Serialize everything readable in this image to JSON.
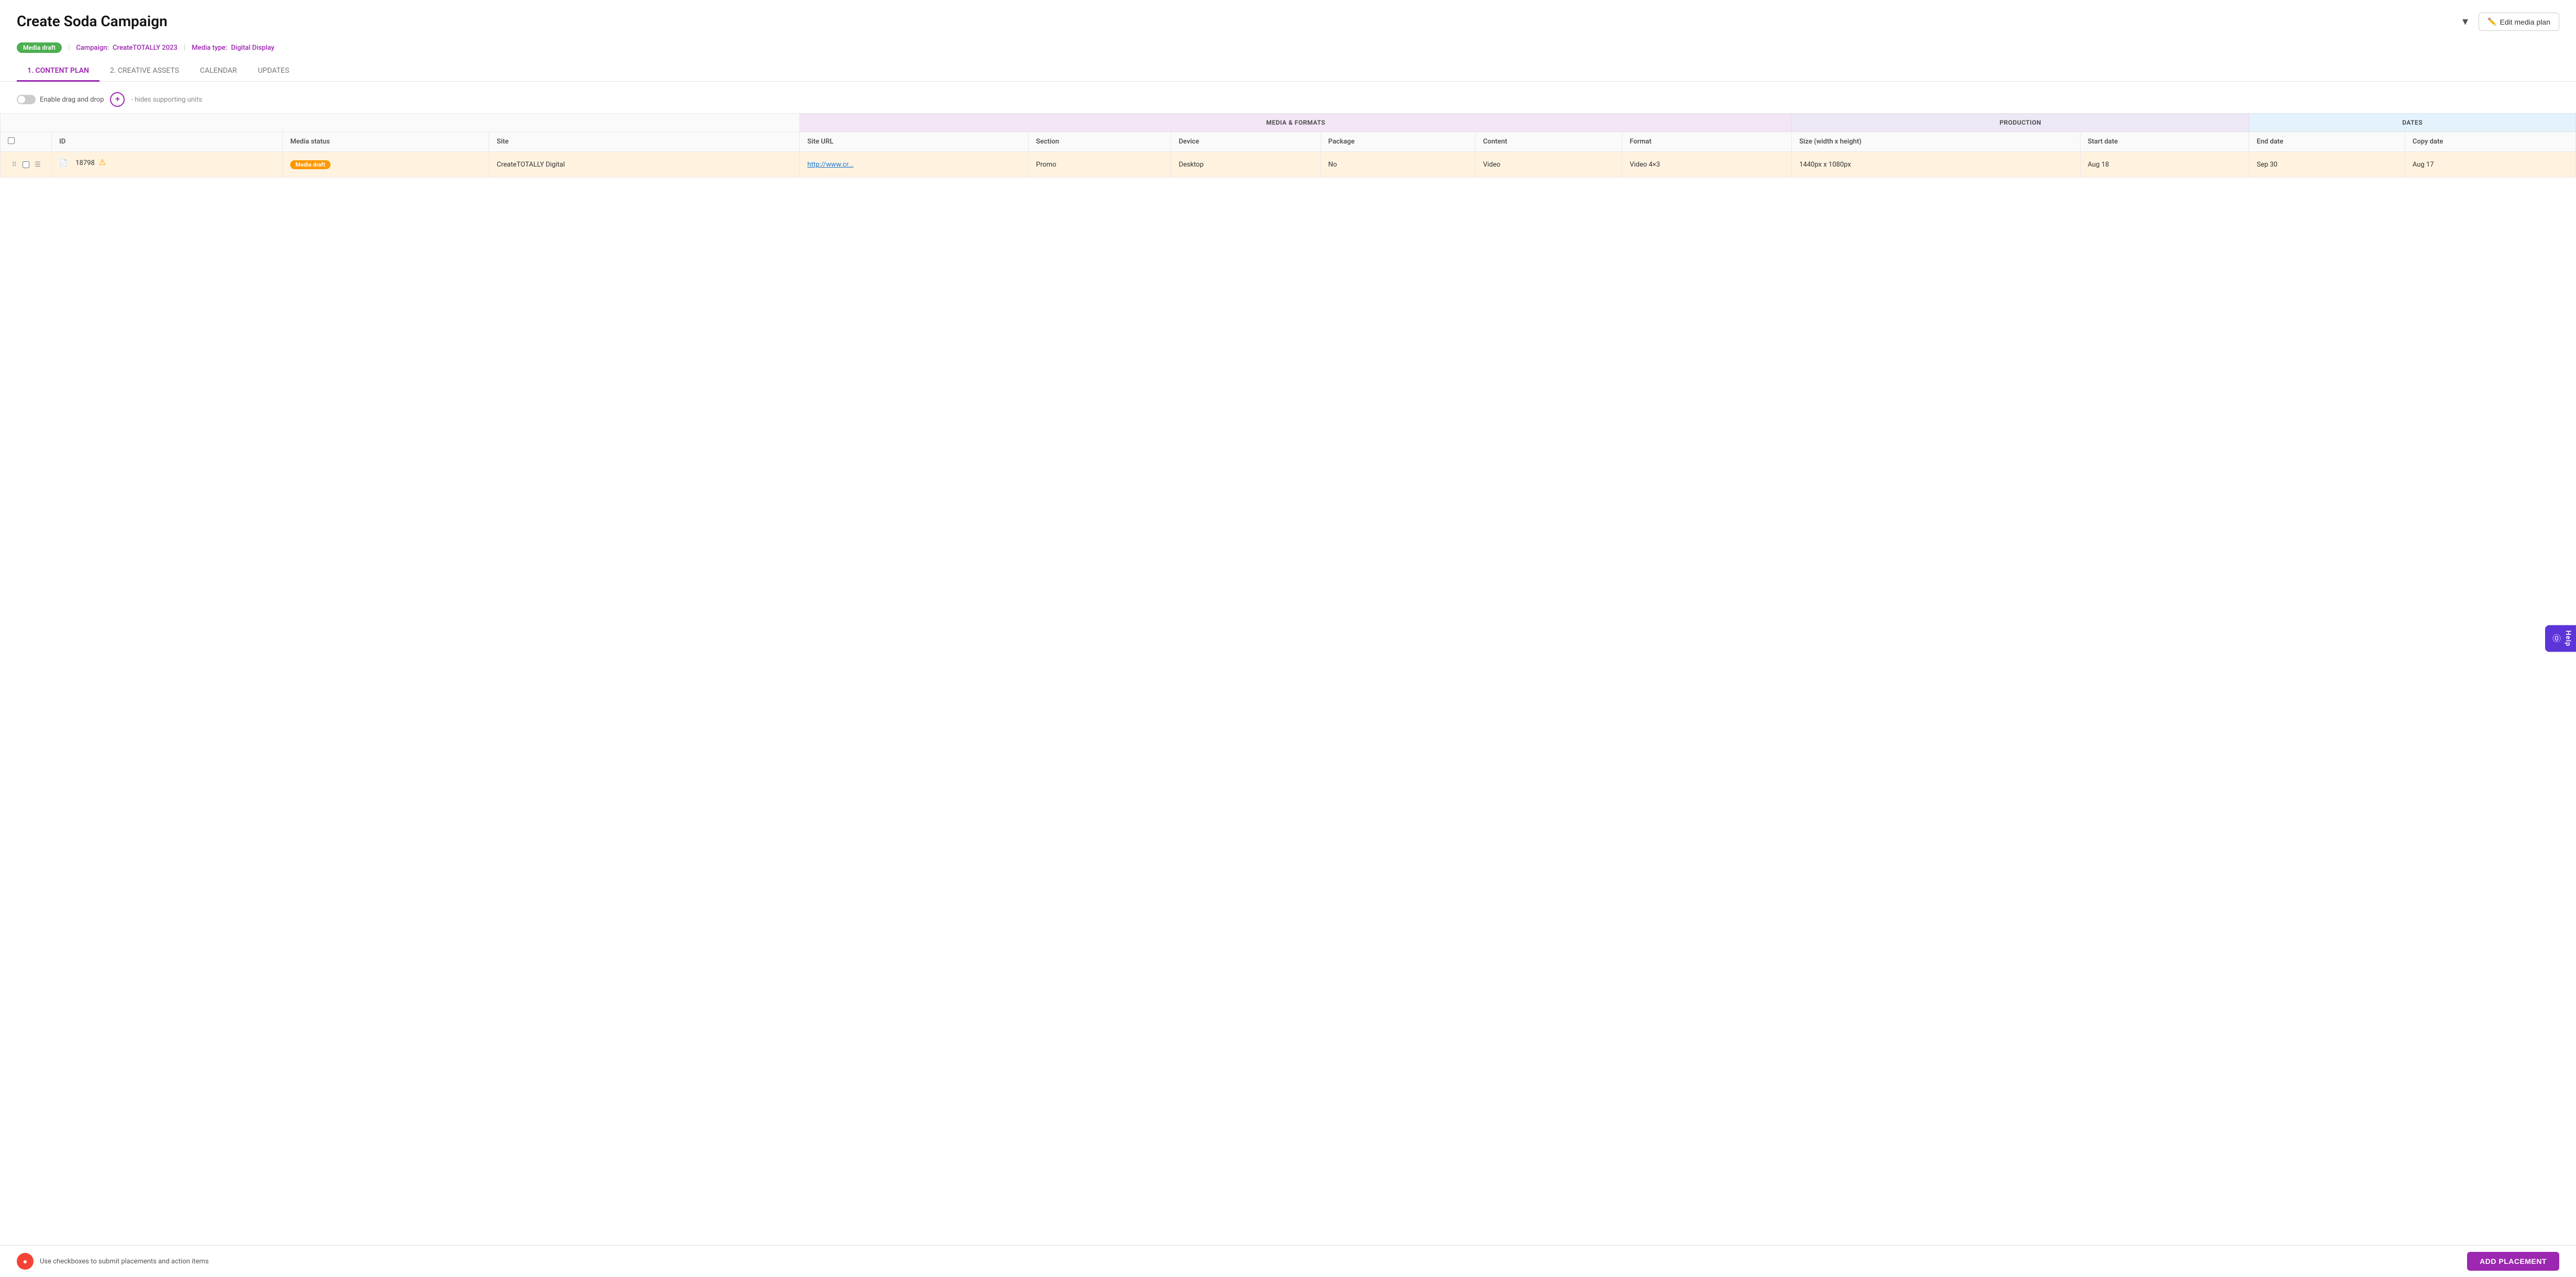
{
  "page": {
    "title": "Create Soda Campaign",
    "chevron": "▾"
  },
  "meta": {
    "badge": "Media draft",
    "campaign_label": "Campaign:",
    "campaign_value": "CreateTOTALLY 2023",
    "media_type_label": "Media type:",
    "media_type_value": "Digital Display"
  },
  "edit_button": "Edit media plan",
  "tabs": [
    {
      "id": "content-plan",
      "label": "1. CONTENT PLAN",
      "active": true
    },
    {
      "id": "creative-assets",
      "label": "2. CREATIVE ASSETS",
      "active": false
    },
    {
      "id": "calendar",
      "label": "CALENDAR",
      "active": false
    },
    {
      "id": "updates",
      "label": "UPDATES",
      "active": false
    }
  ],
  "toolbar": {
    "drag_drop_label": "Enable drag and drop",
    "hides_label": "- hides supporting units"
  },
  "table": {
    "group_headers": [
      {
        "label": "",
        "colspan": 4
      },
      {
        "label": "Media & formats",
        "colspan": 6
      },
      {
        "label": "Production",
        "colspan": 2
      },
      {
        "label": "Dates",
        "colspan": 3
      }
    ],
    "headers": [
      {
        "label": "",
        "key": "checkbox"
      },
      {
        "label": "ID",
        "key": "id"
      },
      {
        "label": "Media status",
        "key": "media_status"
      },
      {
        "label": "Site",
        "key": "site"
      },
      {
        "label": "Site URL",
        "key": "site_url"
      },
      {
        "label": "Section",
        "key": "section"
      },
      {
        "label": "Device",
        "key": "device"
      },
      {
        "label": "Package",
        "key": "package"
      },
      {
        "label": "Content",
        "key": "content"
      },
      {
        "label": "Format",
        "key": "format"
      },
      {
        "label": "Size (width x height)",
        "key": "size"
      },
      {
        "label": "Start date",
        "key": "start_date"
      },
      {
        "label": "End date",
        "key": "end_date"
      },
      {
        "label": "Copy date",
        "key": "copy_date"
      }
    ],
    "rows": [
      {
        "id": "18798",
        "media_status": "Media draft",
        "site": "CreateTOTALLY Digital",
        "site_url": "http://www.cr...",
        "section": "Promo",
        "device": "Desktop",
        "package": "No",
        "content": "Video",
        "format": "Video 4×3",
        "size": "1440px x 1080px",
        "start_date": "Aug 18",
        "end_date": "Sep 30",
        "copy_date": "Aug 17",
        "has_warning": true
      }
    ]
  },
  "footer": {
    "use_checkboxes_text": "Use checkboxes to submit placements and action items",
    "add_placement_label": "ADD PLACEMENT"
  },
  "help": {
    "label": "Help",
    "icon": "?"
  }
}
